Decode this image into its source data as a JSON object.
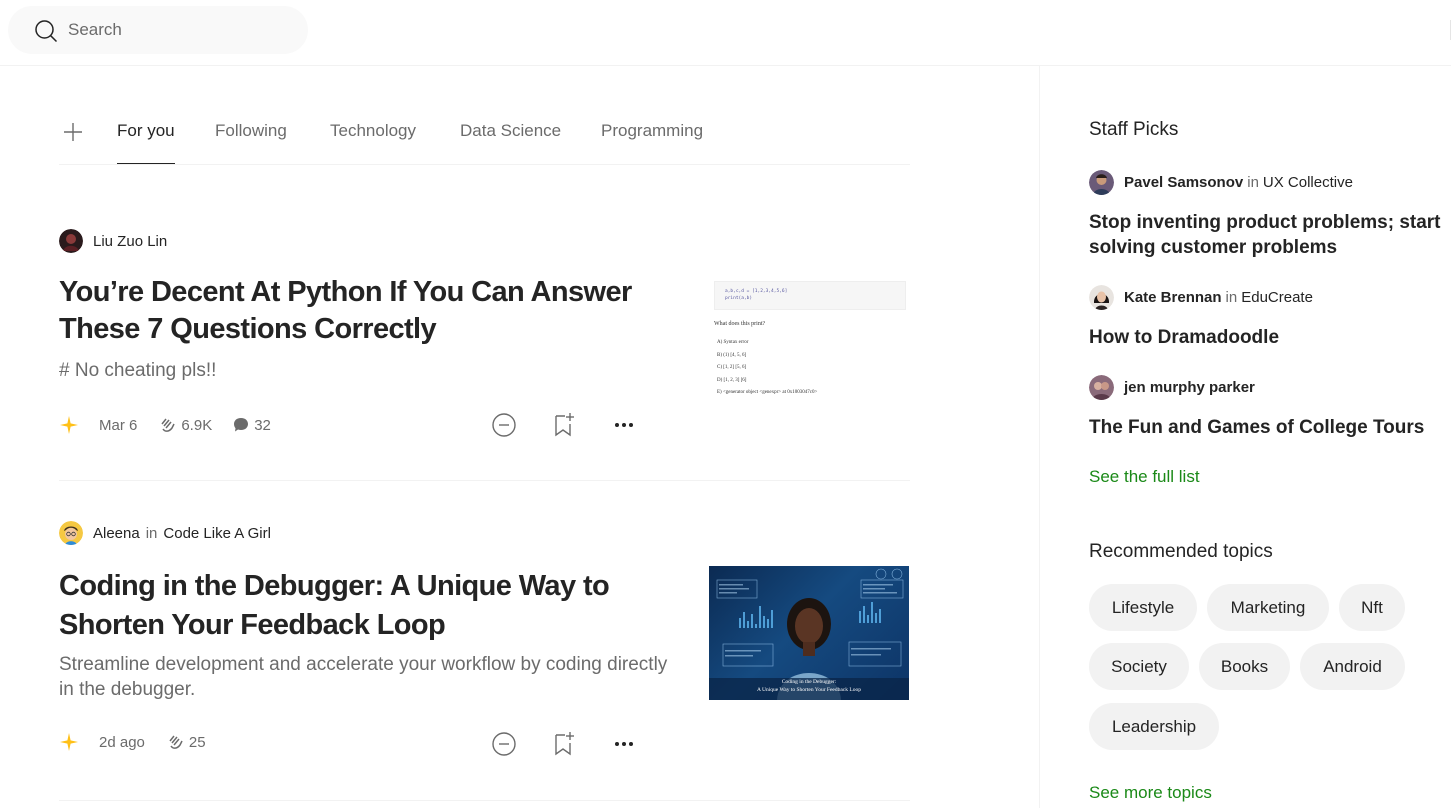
{
  "search": {
    "placeholder": "Search"
  },
  "tabs": [
    {
      "label": "For you",
      "active": true
    },
    {
      "label": "Following",
      "active": false
    },
    {
      "label": "Technology",
      "active": false
    },
    {
      "label": "Data Science",
      "active": false
    },
    {
      "label": "Programming",
      "active": false
    }
  ],
  "articles": [
    {
      "author": "Liu Zuo Lin",
      "publication": "",
      "title": "You’re Decent At Python If You Can Answer These 7 Questions Correctly",
      "subtitle": "# No cheating pls!!",
      "date": "Mar 6",
      "claps": "6.9K",
      "responses": "32",
      "thumbnail": {
        "code_line1": "a,b,c,d = [1,2,3,4,5,6]",
        "code_line2": "print(a,b)",
        "question": "What does this print?",
        "options": [
          "A) Syntax error",
          "B) (1) [4, 5, 6]",
          "C) [1, 2] [5, 6]",
          "D) [1, 2, 3] [6]",
          "E) <generator object <genexpr> at 0x1003047c0>"
        ]
      }
    },
    {
      "author": "Aleena",
      "in": "in",
      "publication": "Code Like A Girl",
      "title": "Coding in the Debugger: A Unique Way to Shorten Your Feedback Loop",
      "subtitle": "Streamline development and accelerate your workflow by coding directly in the debugger.",
      "date": "2d ago",
      "claps": "25",
      "thumbnail": {
        "caption_line1": "Coding in the Debugger:",
        "caption_line2": "A Unique Way to Shorten Your Feedback Loop"
      }
    }
  ],
  "sidebar": {
    "staff_picks_heading": "Staff Picks",
    "picks": [
      {
        "author": "Pavel Samsonov",
        "in": "in",
        "publication": "UX Collective",
        "title": "Stop inventing product problems; start solving customer problems"
      },
      {
        "author": "Kate Brennan",
        "in": "in",
        "publication": "EduCreate",
        "title": "How to Dramadoodle"
      },
      {
        "author": "jen murphy parker",
        "publication": "",
        "title": "The Fun and Games of College Tours"
      }
    ],
    "see_full_list": "See the full list",
    "topics_heading": "Recommended topics",
    "topics": [
      "Lifestyle",
      "Marketing",
      "Nft",
      "Society",
      "Books",
      "Android",
      "Leadership"
    ],
    "see_more_topics": "See more topics"
  },
  "colors": {
    "accent_green": "#1a8917",
    "star_gold": "#ffc017",
    "text_primary": "#242424",
    "text_secondary": "#6b6b6b",
    "chip_bg": "#f2f2f2"
  }
}
